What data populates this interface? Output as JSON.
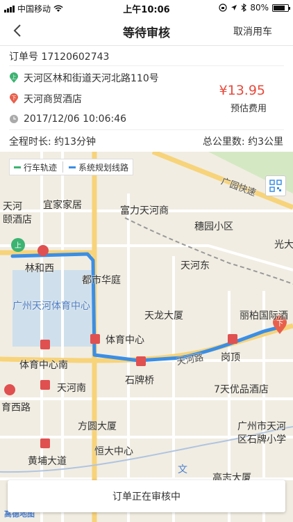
{
  "status_bar": {
    "carrier": "中国移动",
    "time": "上午10:06",
    "battery": "80%",
    "battery_level": 0.8
  },
  "nav": {
    "title": "等待审核",
    "back_icon": "chevron-left-icon",
    "action_label": "取消用车"
  },
  "order": {
    "number_label": "订单号",
    "number": "17120602743",
    "origin": "天河区林和街道天河北路110号",
    "destination": "天河商贸酒店",
    "time": "2017/12/06 10:06:46",
    "price": "¥13.95",
    "price_label": "预估费用",
    "duration": "全程时长: 约13分钟",
    "distance": "总公里数: 约3公里"
  },
  "map": {
    "legend": {
      "track_label": "行车轨迹",
      "track_color": "#3cb371",
      "plan_label": "系统规划线路",
      "plan_color": "#3a8ee6"
    },
    "start_marker": "上",
    "end_marker": "下",
    "labels": {
      "guangyuan_expressway": "广园快速",
      "tianhe_top": "天河",
      "tianhe_hospital": "颐酒店",
      "yijia": "宜家家居",
      "fuli": "富力天河商",
      "suiyuan": "穗园小区",
      "guang": "光大",
      "linhexi": "林和西",
      "duhuating": "都市华庭",
      "tianhedong": "天河东",
      "stadium": "广州天河体育中心",
      "tianlong": "天龙大厦",
      "libai": "丽柏国际酒",
      "tiyuzhongxin": "体育中心",
      "tiyuzhongxinnan": "体育中心南",
      "tianhelu": "天河路",
      "shipaiqiao": "石牌桥",
      "gangding": "岗顶",
      "tianhenan": "天河南",
      "qitian": "7天优品酒店",
      "tiyuxilu": "育西路",
      "fangyuan": "方圆大厦",
      "guangzhou_tianhe": "广州市天河",
      "shipai_school": "区石牌小学",
      "hengda": "恒大中心",
      "huangpu": "黄埔大道",
      "gaozhi": "高志大厦",
      "wenhua": "文"
    },
    "attribution": "高德地图"
  },
  "footer": {
    "status": "订单正在审核中"
  }
}
